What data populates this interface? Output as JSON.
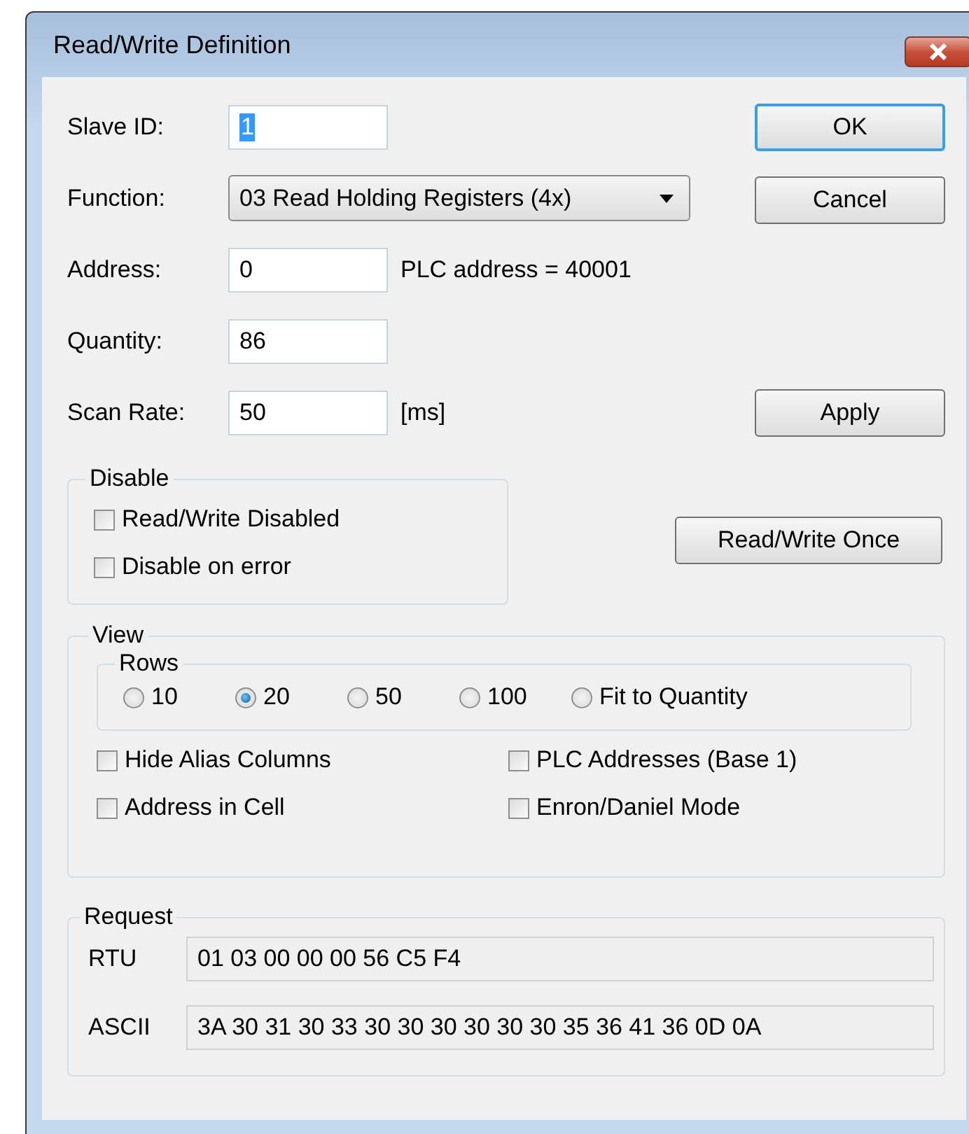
{
  "window": {
    "title": "Read/Write Definition"
  },
  "fields": [
    {
      "label": "Slave ID:",
      "kind": "input",
      "value": "1",
      "text_selected": true,
      "button": {
        "label": "OK",
        "default": true
      }
    },
    {
      "label": "Function:",
      "kind": "combo",
      "value": "03 Read Holding Registers (4x)",
      "text_selected": false,
      "button": {
        "label": "Cancel",
        "default": false
      }
    },
    {
      "label": "Address:",
      "kind": "input",
      "value": "0",
      "text_selected": false,
      "note": "PLC address = 40001"
    },
    {
      "label": "Quantity:",
      "kind": "input",
      "value": "86",
      "text_selected": false
    },
    {
      "label": "Scan Rate:",
      "kind": "input",
      "value": "50",
      "text_selected": false,
      "note": "[ms]",
      "button": {
        "label": "Apply",
        "default": false
      }
    }
  ],
  "disable": {
    "title": "Disable",
    "options": [
      {
        "label": "Read/Write Disabled",
        "checked": false
      },
      {
        "label": "Disable on error",
        "checked": false
      }
    ]
  },
  "once_button": {
    "label": "Read/Write Once"
  },
  "view": {
    "title": "View",
    "rows": {
      "title": "Rows",
      "options": [
        {
          "label": "10",
          "selected": false
        },
        {
          "label": "20",
          "selected": true
        },
        {
          "label": "50",
          "selected": false
        },
        {
          "label": "100",
          "selected": false
        },
        {
          "label": "Fit to Quantity",
          "selected": false
        }
      ]
    },
    "options": [
      {
        "label": "Hide Alias Columns",
        "checked": false
      },
      {
        "label": "PLC Addresses (Base 1)",
        "checked": false
      },
      {
        "label": "Address in Cell",
        "checked": false
      },
      {
        "label": "Enron/Daniel Mode",
        "checked": false
      }
    ]
  },
  "request": {
    "title": "Request",
    "lines": [
      {
        "label": "RTU",
        "value": "01 03 00 00 00 56 C5 F4"
      },
      {
        "label": "ASCII",
        "value": "3A 30 31 30 33 30 30 30 30 30 30 35 36 41 36 0D 0A"
      }
    ]
  }
}
